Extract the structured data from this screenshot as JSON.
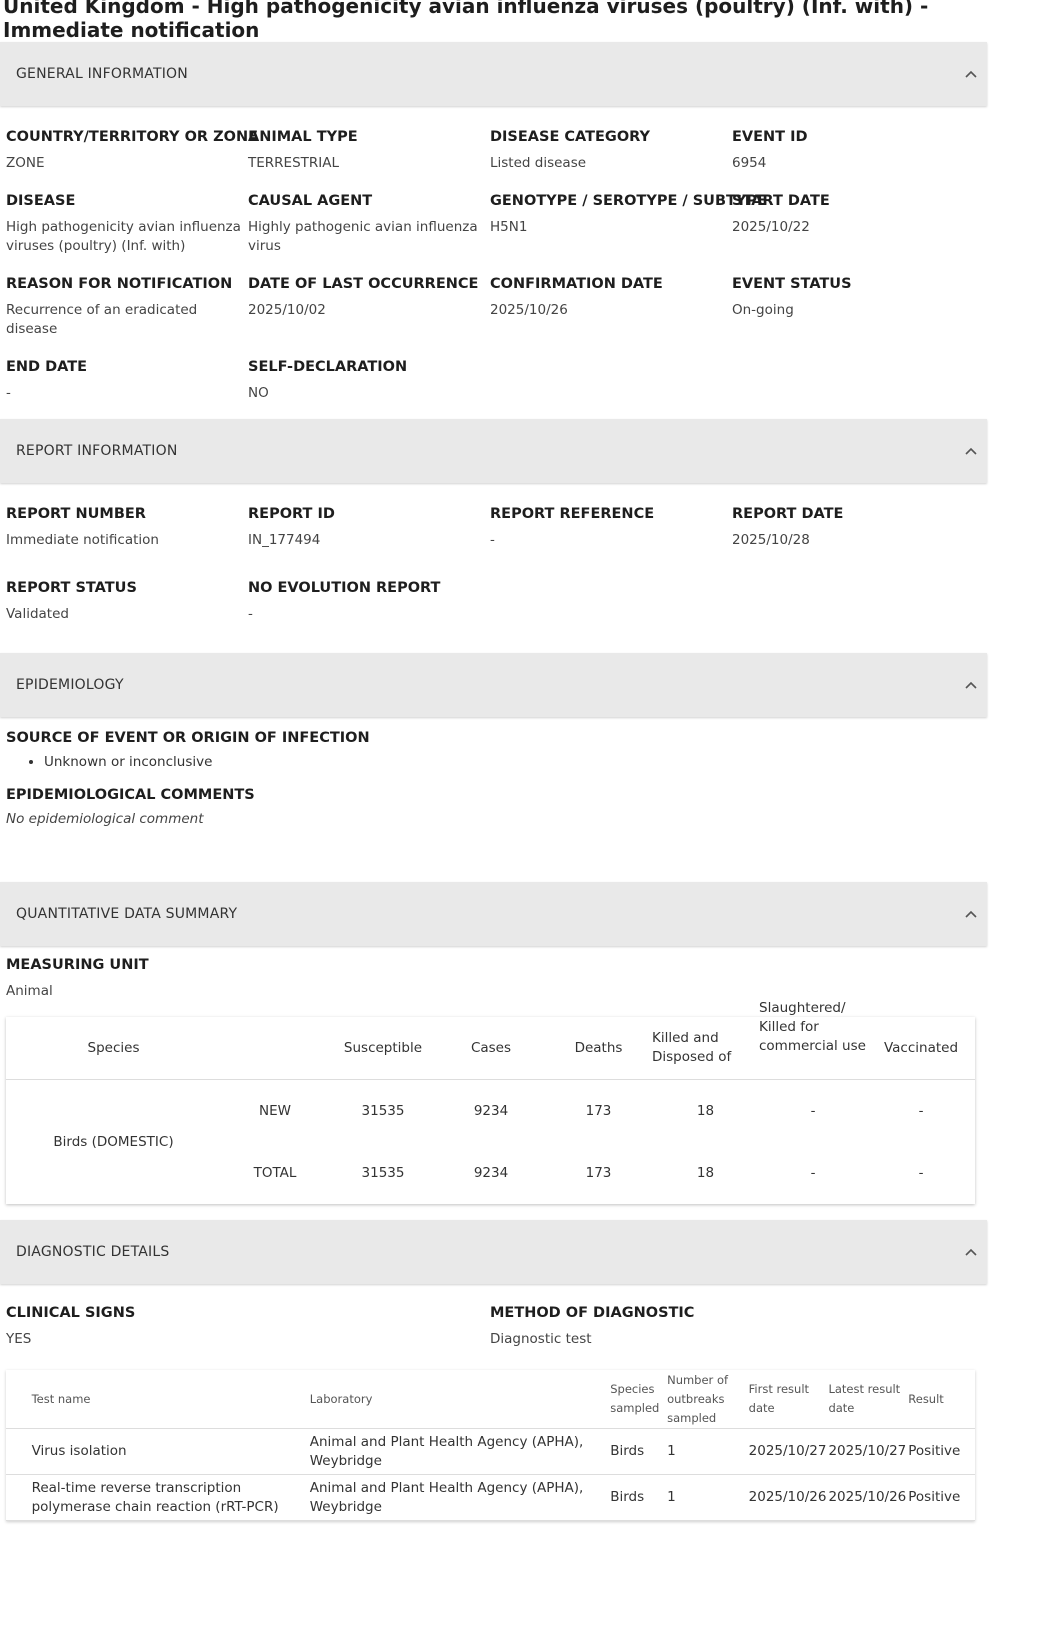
{
  "page": {
    "title": "United Kingdom - High pathogenicity avian influenza viruses (poultry) (Inf. with) - Immediate notification"
  },
  "sections": {
    "general": "GENERAL INFORMATION",
    "report": "REPORT INFORMATION",
    "epidemiology": "EPIDEMIOLOGY",
    "quantitative": "QUANTITATIVE DATA SUMMARY",
    "diagnostic": "DIAGNOSTIC DETAILS"
  },
  "general": {
    "country_label": "COUNTRY/TERRITORY OR ZONE",
    "country_value": "ZONE",
    "animal_type_label": "ANIMAL TYPE",
    "animal_type_value": "TERRESTRIAL",
    "disease_category_label": "DISEASE CATEGORY",
    "disease_category_value": "Listed disease",
    "event_id_label": "EVENT ID",
    "event_id_value": "6954",
    "disease_label": "DISEASE",
    "disease_value": "High pathogenicity avian influenza viruses (poultry) (Inf. with)",
    "causal_agent_label": "CAUSAL AGENT",
    "causal_agent_value": "Highly pathogenic avian influenza virus",
    "genotype_label": "GENOTYPE / SEROTYPE / SUBTYPE",
    "genotype_value": "H5N1",
    "start_date_label": "START DATE",
    "start_date_value": "2025/10/22",
    "reason_label": "REASON FOR NOTIFICATION",
    "reason_value": "Recurrence of an eradicated disease",
    "last_occurrence_label": "DATE OF LAST OCCURRENCE",
    "last_occurrence_value": "2025/10/02",
    "confirmation_label": "CONFIRMATION DATE",
    "confirmation_value": "2025/10/26",
    "event_status_label": "EVENT STATUS",
    "event_status_value": "On-going",
    "end_date_label": "END DATE",
    "end_date_value": "-",
    "self_decl_label": "SELF-DECLARATION",
    "self_decl_value": "NO"
  },
  "report": {
    "number_label": "REPORT NUMBER",
    "number_value": "Immediate notification",
    "id_label": "REPORT ID",
    "id_value": "IN_177494",
    "reference_label": "REPORT REFERENCE",
    "reference_value": "-",
    "date_label": "REPORT DATE",
    "date_value": "2025/10/28",
    "status_label": "REPORT STATUS",
    "status_value": "Validated",
    "no_evolution_label": "NO EVOLUTION REPORT",
    "no_evolution_value": "-"
  },
  "epidemiology": {
    "source_label": "SOURCE OF EVENT OR ORIGIN OF INFECTION",
    "source_items": [
      "Unknown or inconclusive"
    ],
    "comments_label": "EPIDEMIOLOGICAL COMMENTS",
    "comments_value": "No epidemiological comment"
  },
  "quantitative": {
    "unit_label": "MEASURING UNIT",
    "unit_value": "Animal",
    "headers": [
      "Species",
      "Susceptible",
      "Cases",
      "Deaths",
      "Killed and Disposed of",
      "Slaughtered/ Killed for commercial use",
      "Vaccinated"
    ],
    "species": "Birds (DOMESTIC)",
    "rows": [
      {
        "label": "NEW",
        "values": [
          "31535",
          "9234",
          "173",
          "18",
          "-",
          "-"
        ]
      },
      {
        "label": "TOTAL",
        "values": [
          "31535",
          "9234",
          "173",
          "18",
          "-",
          "-"
        ]
      }
    ]
  },
  "diagnostic": {
    "clinical_label": "CLINICAL SIGNS",
    "clinical_value": "YES",
    "method_label": "METHOD OF DIAGNOSTIC",
    "method_value": "Diagnostic test",
    "headers": [
      "Test name",
      "Laboratory",
      "Species sampled",
      "Number of outbreaks sampled",
      "First result date",
      "Latest result date",
      "Result"
    ],
    "rows": [
      [
        "Virus isolation",
        "Animal and Plant Health Agency (APHA), Weybridge",
        "Birds",
        "1",
        "2025/10/27",
        "2025/10/27",
        "Positive"
      ],
      [
        "Real-time reverse transcription polymerase chain reaction (rRT-PCR)",
        "Animal and Plant Health Agency (APHA), Weybridge",
        "Birds",
        "1",
        "2025/10/26",
        "2025/10/26",
        "Positive"
      ]
    ]
  }
}
